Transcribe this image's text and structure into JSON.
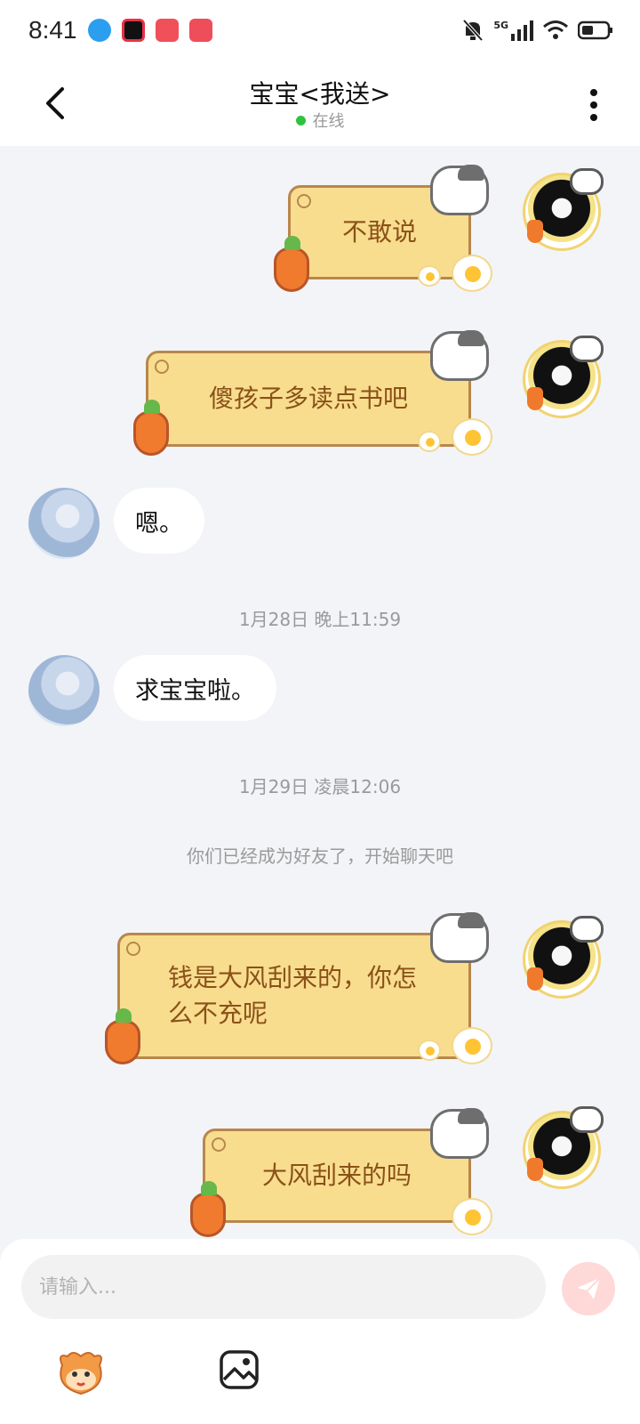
{
  "status_bar": {
    "time": "8:41",
    "network": "5G",
    "icons": [
      "blue-app-icon",
      "red-camera-app-icon",
      "red-shopping-app-icon",
      "red-book-app-icon",
      "mute-bell-icon",
      "signal-icon",
      "wifi-icon",
      "battery-icon"
    ]
  },
  "header": {
    "title": "宝宝<我送>",
    "status": "在线",
    "status_color": "#2fc33d"
  },
  "messages": [
    {
      "sender": "me",
      "text": "不敢说"
    },
    {
      "sender": "me",
      "text": "傻孩子多读点书吧"
    },
    {
      "sender": "her",
      "text": "嗯。"
    },
    {
      "sender": "her",
      "text": "求宝宝啦。"
    },
    {
      "sender": "me",
      "text": "钱是大风刮来的，你怎么不充呢"
    },
    {
      "sender": "me",
      "text": "大风刮来的吗"
    }
  ],
  "timestamps": [
    "1月28日 晚上11:59",
    "1月29日 凌晨12:06"
  ],
  "system_note": "你们已经成为好友了，开始聊天吧",
  "input": {
    "placeholder": "请输入..."
  },
  "colors": {
    "bubble_yellow": "#f8dd8f",
    "bubble_text": "#8a5118",
    "send_button": "#ffd8d8"
  }
}
